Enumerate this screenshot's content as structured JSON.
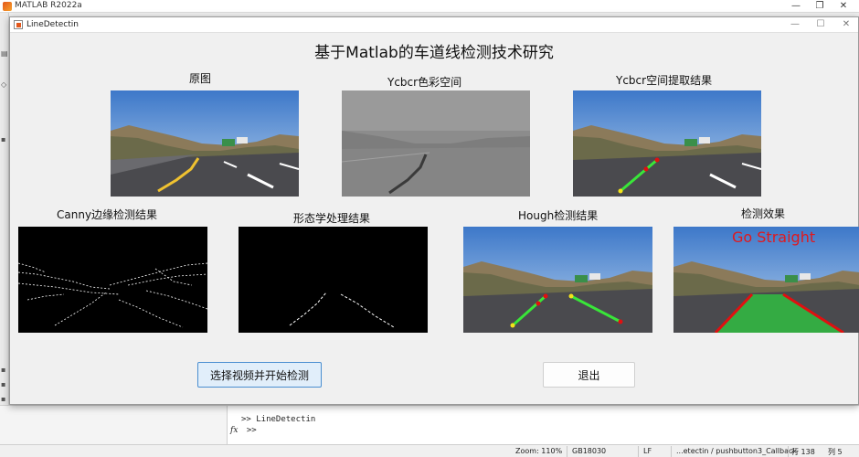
{
  "app": {
    "matlab_title": "MATLAB R2022a",
    "figure_title": "LineDetectin"
  },
  "figure": {
    "main_title": "基于Matlab的车道线检测技术研究",
    "panels": [
      {
        "key": "original",
        "label": "原图"
      },
      {
        "key": "ycbcr",
        "label": "Ycbcr色彩空间"
      },
      {
        "key": "ycbcr_extract",
        "label": "Ycbcr空间提取结果"
      },
      {
        "key": "canny",
        "label": "Canny边缘检测结果"
      },
      {
        "key": "morph",
        "label": "形态学处理结果"
      },
      {
        "key": "hough",
        "label": "Hough检测结果"
      },
      {
        "key": "detect",
        "label": "检测效果"
      }
    ],
    "overlay_text": "Go Straight",
    "start_button": "选择视频并开始检测",
    "exit_button": "退出"
  },
  "command_window": {
    "history": ">> LineDetectin",
    "prompt": ">>",
    "fx_symbol": "fx"
  },
  "statusbar": {
    "zoom": "Zoom: 110%",
    "encoding": "GB18030",
    "line_ending": "LF",
    "callback": "...etectin / pushbutton3_Callback",
    "row": "行 138",
    "col": "列 5"
  },
  "colors": {
    "accent_button_bg": "#e1eefa",
    "accent_button_border": "#4a8ed0",
    "go_straight_text": "#e0191e",
    "lane_fill": "#2ecc40",
    "lane_edge": "#e01010",
    "hough_line": "#39e639"
  }
}
